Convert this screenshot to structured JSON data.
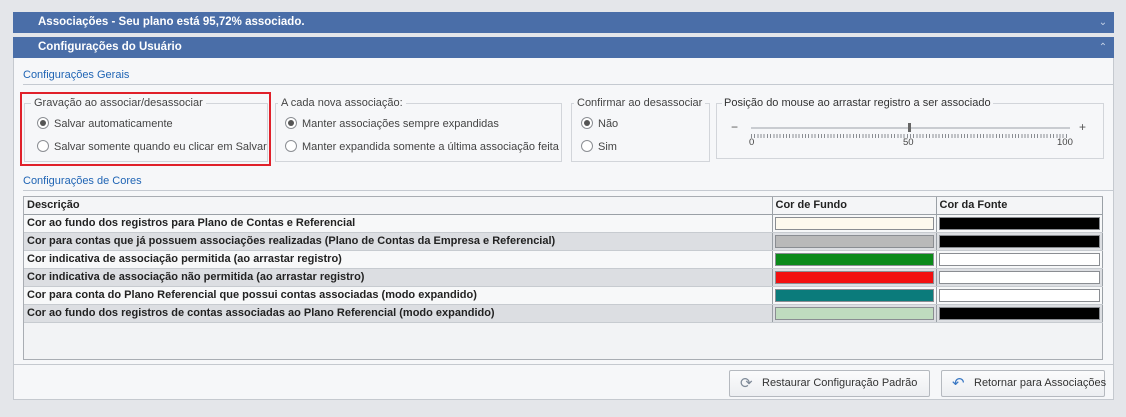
{
  "header": {
    "associations_bar": "Associações - Seu plano está 95,72% associado.",
    "user_config_bar": "Configurações do Usuário"
  },
  "general": {
    "section_title": "Configurações Gerais",
    "save_group": {
      "title": "Gravação ao associar/desassociar",
      "options": [
        "Salvar automaticamente",
        "Salvar somente quando eu clicar em Salvar"
      ],
      "selected": 0
    },
    "new_assoc_group": {
      "title": "A cada nova associação:",
      "options": [
        "Manter associações sempre expandidas",
        "Manter expandida somente a última associação feita"
      ],
      "selected": 0
    },
    "confirm_group": {
      "title": "Confirmar ao desassociar",
      "options": [
        "Não",
        "Sim"
      ],
      "selected": 0
    },
    "mouse_slider": {
      "title": "Posição do mouse ao arrastar registro a ser associado",
      "minus": "−",
      "plus": "+",
      "min_label": "0",
      "mid_label": "50",
      "max_label": "100",
      "value": 50
    }
  },
  "colors": {
    "section_title": "Configurações de Cores",
    "columns": [
      "Descrição",
      "Cor de Fundo",
      "Cor da Fonte"
    ],
    "rows": [
      {
        "desc": "Cor ao fundo dos registros para Plano de Contas e Referencial",
        "bg": "#fdf9ee",
        "font": "#000000"
      },
      {
        "desc": "Cor para contas que já possuem associações realizadas (Plano de Contas da Empresa e Referencial)",
        "bg": "#b9b9b9",
        "font": "#000000"
      },
      {
        "desc": "Cor indicativa de associação permitida (ao arrastar registro)",
        "bg": "#0b8a1a",
        "font": "#ffffff"
      },
      {
        "desc": "Cor indicativa de associação não permitida (ao arrastar registro)",
        "bg": "#f20f0f",
        "font": "#ffffff"
      },
      {
        "desc": "Cor para conta do Plano Referencial que possui contas associadas (modo expandido)",
        "bg": "#0b7b7b",
        "font": "#ffffff"
      },
      {
        "desc": "Cor ao fundo dos registros de contas associadas ao Plano Referencial (modo expandido)",
        "bg": "#bfdcbf",
        "font": "#000000"
      }
    ]
  },
  "buttons": {
    "restore": "Restaurar Configuração Padrão",
    "back": "Retornar para Associações"
  },
  "icons": {
    "collapse": "chevron-down-icon",
    "expand": "chevron-up-icon",
    "restore": "restore-icon",
    "back": "return-arrow-icon"
  }
}
